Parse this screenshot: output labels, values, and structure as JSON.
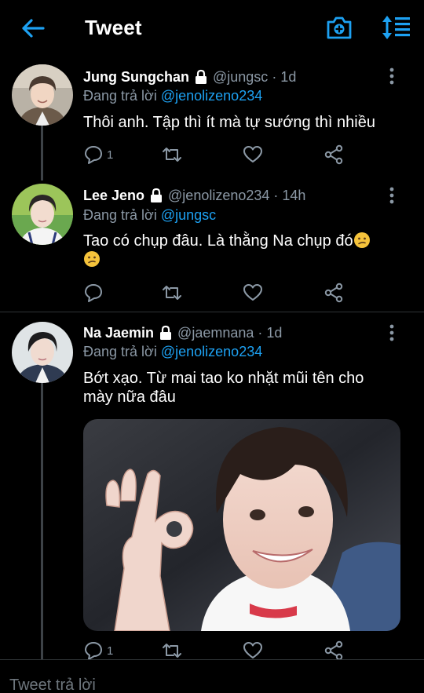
{
  "header": {
    "title": "Tweet",
    "back_icon": "arrow-left-icon",
    "camera_icon": "camera-add-icon",
    "sort_icon": "sort-thread-icon",
    "accent": "#1da1f2"
  },
  "tweets": [
    {
      "display_name": "Jung Sungchan",
      "handle": "@jungsc",
      "time": "· 1d",
      "replying_prefix": "Đang trả lời",
      "replying_to": "@jenolizeno234",
      "text": "Thôi anh. Tập thì ít mà tự sướng thì nhiều",
      "reply_count": "1",
      "retweet_count": "",
      "like_count": ""
    },
    {
      "display_name": "Lee Jeno",
      "handle": "@jenolizeno234",
      "time": "· 14h",
      "replying_prefix": "Đang trả lời",
      "replying_to": "@jungsc",
      "text": "Tao có chụp đâu. Là thằng Na chụp đó",
      "reply_count": "",
      "retweet_count": "",
      "like_count": ""
    },
    {
      "display_name": "Na Jaemin",
      "handle": "@jaemnana",
      "time": "· 1d",
      "replying_prefix": "Đang trả lời",
      "replying_to": "@jenolizeno234",
      "text": "Bớt xạo. Từ mai tao ko nhặt mũi tên cho mày nữa đâu",
      "reply_count": "1",
      "retweet_count": "",
      "like_count": ""
    }
  ],
  "reply_box": {
    "placeholder": "Tweet trả lời"
  },
  "colors": {
    "background": "#000000",
    "secondary_text": "#8b98a5",
    "link": "#1da1f2",
    "divider": "#2f3336"
  }
}
